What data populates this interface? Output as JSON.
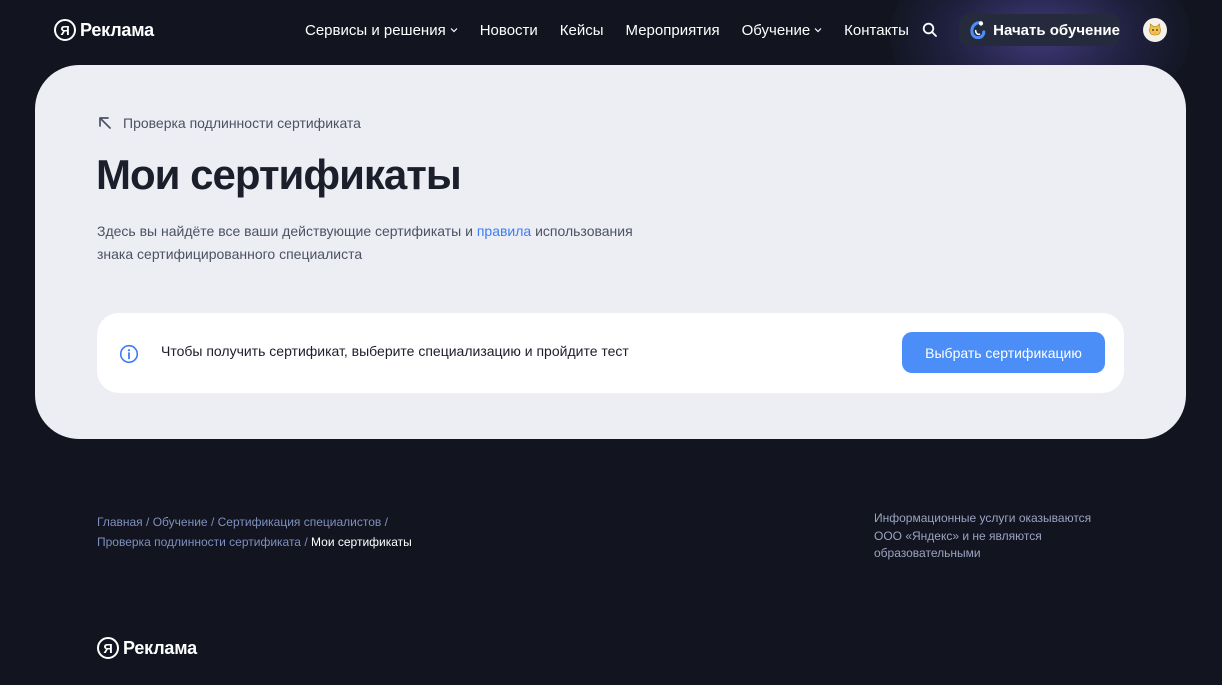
{
  "header": {
    "logo_text": "Реклама",
    "logo_mark": "Я",
    "nav": [
      {
        "label": "Сервисы и решения",
        "has_dropdown": true
      },
      {
        "label": "Новости",
        "has_dropdown": false
      },
      {
        "label": "Кейсы",
        "has_dropdown": false
      },
      {
        "label": "Мероприятия",
        "has_dropdown": false
      },
      {
        "label": "Обучение",
        "has_dropdown": true
      },
      {
        "label": "Контакты",
        "has_dropdown": false
      }
    ],
    "search_icon": "search-icon",
    "start_button": "Начать обучение",
    "avatar_icon": "cat-face-icon"
  },
  "main": {
    "back_link": "Проверка подлинности сертификата",
    "title": "Мои сертификаты",
    "description_before": "Здесь вы найдёте все ваши действующие сертификаты и ",
    "description_link": "правила",
    "description_after": " использования знака сертифицированного специалиста",
    "notice_text": "Чтобы получить сертификат, выберите специализацию и пройдите тест",
    "notice_button": "Выбрать сертификацию"
  },
  "footer": {
    "breadcrumbs": [
      "Главная",
      "Обучение",
      "Сертификация специалистов",
      "Проверка подлинности сертификата"
    ],
    "breadcrumb_current": "Мои сертификаты",
    "breadcrumb_separator": "/",
    "disclaimer": "Информационные услуги оказываются ООО «Яндекс» и не являются образовательными",
    "logo_text": "Реклама",
    "logo_mark": "Я"
  },
  "colors": {
    "background": "#12151f",
    "card": "#eceef4",
    "accent": "#4b8ef7",
    "link": "#3c7cf5"
  }
}
